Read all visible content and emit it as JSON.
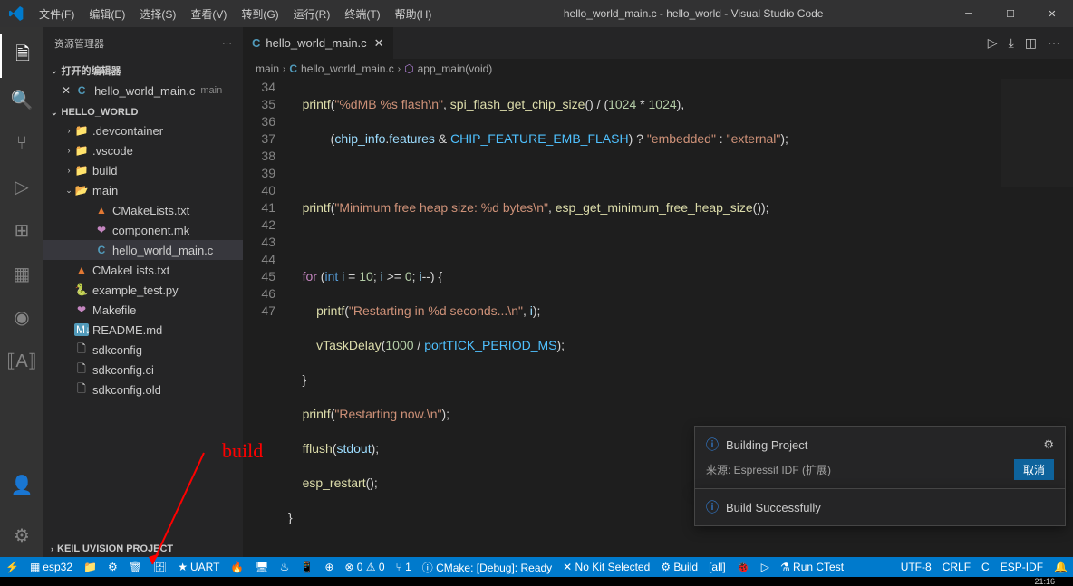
{
  "window_title": "hello_world_main.c - hello_world - Visual Studio Code",
  "menu": {
    "file": "文件(F)",
    "edit": "编辑(E)",
    "select": "选择(S)",
    "view": "查看(V)",
    "goto": "转到(G)",
    "run": "运行(R)",
    "terminal": "终端(T)",
    "help": "帮助(H)"
  },
  "sidebar": {
    "title": "资源管理器",
    "open_editors": "打开的编辑器",
    "open_file": "hello_world_main.c",
    "open_file_dir": "main",
    "project": "HELLO_WORLD",
    "tree": [
      {
        "pad": 22,
        "chev": "›",
        "icon_cls": "folder-yellow",
        "icon": "📁",
        "name": ".devcontainer"
      },
      {
        "pad": 22,
        "chev": "›",
        "icon_cls": "folder-yellow",
        "icon": "📁",
        "name": ".vscode"
      },
      {
        "pad": 22,
        "chev": "›",
        "icon_cls": "folder-yellow",
        "icon": "📁",
        "name": "build"
      },
      {
        "pad": 22,
        "chev": "⌄",
        "icon_cls": "folder-yellow",
        "icon": "📂",
        "name": "main"
      },
      {
        "pad": 44,
        "chev": "",
        "icon_cls": "tri-icon",
        "icon": "▲",
        "name": "CMakeLists.txt"
      },
      {
        "pad": 44,
        "chev": "",
        "icon_cls": "heart-icon",
        "icon": "❤",
        "name": "component.mk"
      },
      {
        "pad": 44,
        "chev": "",
        "icon_cls": "c-icon",
        "icon": "C",
        "name": "hello_world_main.c",
        "sel": true
      },
      {
        "pad": 22,
        "chev": "",
        "icon_cls": "tri-icon",
        "icon": "▲",
        "name": "CMakeLists.txt"
      },
      {
        "pad": 22,
        "chev": "",
        "icon_cls": "py-icon",
        "icon": "🐍",
        "name": "example_test.py"
      },
      {
        "pad": 22,
        "chev": "",
        "icon_cls": "heart-icon",
        "icon": "❤",
        "name": "Makefile"
      },
      {
        "pad": 22,
        "chev": "",
        "icon_cls": "md-icon",
        "icon": "M↓",
        "name": "README.md"
      },
      {
        "pad": 22,
        "chev": "",
        "icon_cls": "file-icon",
        "icon": "🗋",
        "name": "sdkconfig"
      },
      {
        "pad": 22,
        "chev": "",
        "icon_cls": "file-icon",
        "icon": "🗋",
        "name": "sdkconfig.ci"
      },
      {
        "pad": 22,
        "chev": "",
        "icon_cls": "file-icon",
        "icon": "🗋",
        "name": "sdkconfig.old"
      }
    ],
    "keil": "KEIL UVISION PROJECT"
  },
  "tab": {
    "name": "hello_world_main.c"
  },
  "breadcrumb": {
    "p1": "main",
    "p2": "hello_world_main.c",
    "p3": "app_main(void)"
  },
  "lines": [
    "34",
    "35",
    "36",
    "37",
    "38",
    "39",
    "40",
    "41",
    "42",
    "43",
    "44",
    "45",
    "46",
    "47"
  ],
  "status": {
    "plug": "⚡",
    "target": "esp32",
    "folder": "📁",
    "gear": "⚙",
    "trash": "🗑",
    "db": "🗄",
    "star": "★",
    "uart": "UART",
    "flame": "🔥",
    "monitor": "🖥",
    "fire": "♨",
    "app": "📱",
    "add": "⊕",
    "err": "⊗ 0 ⚠ 0",
    "fork": "⑂ 1",
    "cmake": "ⓘ CMake: [Debug]: Ready",
    "kit": "✕ No Kit Selected",
    "build": "⚙ Build",
    "all": "[all]",
    "bug": "🐞",
    "play": "▷",
    "ctest": "⚗ Run CTest",
    "enc": "UTF-8",
    "eol": "CRLF",
    "lang": "C",
    "idf": "ESP-IDF",
    "bell": "🔔"
  },
  "notif1": {
    "title": "Building Project",
    "source": "来源: Espressif IDF (扩展)",
    "cancel": "取消"
  },
  "notif2": {
    "title": "Build Successfully"
  },
  "annotation": "build",
  "taskbar_time": "21:16"
}
